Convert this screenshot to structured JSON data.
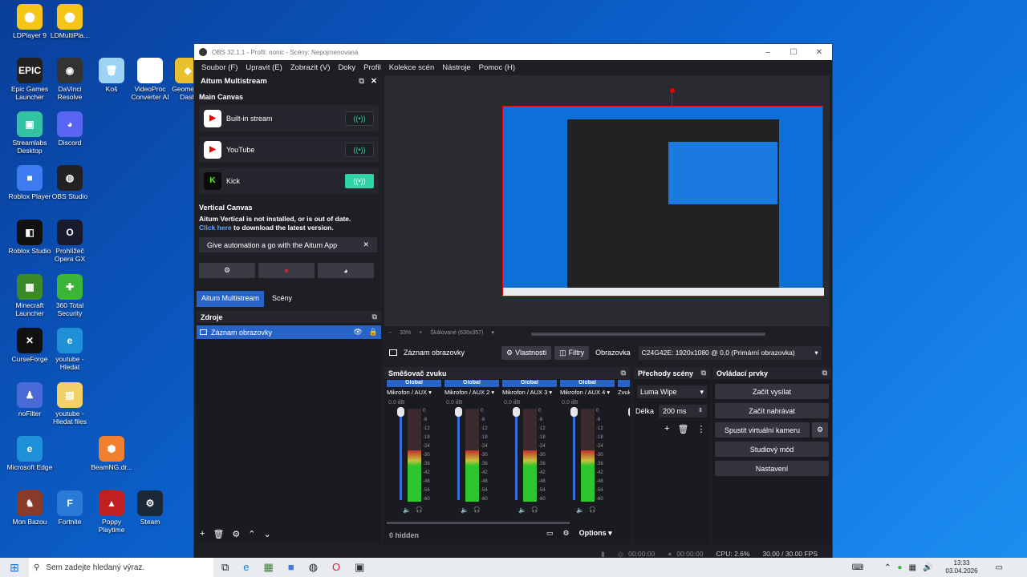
{
  "desktop_icons": [
    {
      "label": "LDPlayer 9",
      "color": "#f5c518",
      "glyph": "⬤"
    },
    {
      "label": "LDMultiPla...",
      "color": "#f5c518",
      "glyph": "⬤"
    },
    {
      "label": "Epic Games Launcher",
      "color": "#222",
      "glyph": "EPIC"
    },
    {
      "label": "DaVinci Resolve",
      "color": "#333",
      "glyph": "◉"
    },
    {
      "label": "Koš",
      "color": "#9fd3f5",
      "glyph": "🗑"
    },
    {
      "label": "VideoProc Converter AI",
      "color": "#fff",
      "glyph": "◎"
    },
    {
      "label": "Geometr... Dash",
      "color": "#e8c030",
      "glyph": "◆"
    },
    {
      "label": "Streamlabs Desktop",
      "color": "#31c3a2",
      "glyph": "▣"
    },
    {
      "label": "Discord",
      "color": "#5865f2",
      "glyph": "◕"
    },
    {
      "label": "Roblox Player",
      "color": "#3c7cf0",
      "glyph": "■"
    },
    {
      "label": "OBS Studio",
      "color": "#222",
      "glyph": "◍"
    },
    {
      "label": "Roblox Studio",
      "color": "#111",
      "glyph": "◧"
    },
    {
      "label": "Prohlížeč Opera GX",
      "color": "#1a1a2e",
      "glyph": "O"
    },
    {
      "label": "Minecraft Launcher",
      "color": "#3a8a2a",
      "glyph": "▦"
    },
    {
      "label": "360 Total Security",
      "color": "#3ab53a",
      "glyph": "✚"
    },
    {
      "label": "CurseForge",
      "color": "#111",
      "glyph": "✕"
    },
    {
      "label": "youtube - Hledat",
      "color": "#1e90d8",
      "glyph": "e"
    },
    {
      "label": "noFilter",
      "color": "#4a6ad8",
      "glyph": "♟"
    },
    {
      "label": "youtube - Hledat files",
      "color": "#f3d06a",
      "glyph": "▤"
    },
    {
      "label": "Microsoft Edge",
      "color": "#1e90d8",
      "glyph": "e"
    },
    {
      "label": "BeamNG.dr...",
      "color": "#f08030",
      "glyph": "⬢"
    },
    {
      "label": "Mon Bazou",
      "color": "#8a3a2a",
      "glyph": "♞"
    },
    {
      "label": "Fortnite",
      "color": "#2a7ad8",
      "glyph": "F"
    },
    {
      "label": "Poppy Playtime",
      "color": "#c02020",
      "glyph": "▲"
    },
    {
      "label": "Steam",
      "color": "#1b2838",
      "glyph": "⚙"
    }
  ],
  "obs": {
    "title": "OBS 32.1.1 - Profil: nonic - Scény: Nepojmenovaná",
    "menu": [
      "Soubor (F)",
      "Upravit (E)",
      "Zobrazit (V)",
      "Doky",
      "Profil",
      "Kolekce scén",
      "Nástroje",
      "Pomoc (H)"
    ],
    "aitum": {
      "header": "Aitum Multistream",
      "main_canvas": "Main Canvas",
      "streams": [
        {
          "name": "Built-in stream",
          "active": false,
          "icon": "youtube-icon"
        },
        {
          "name": "YouTube",
          "active": false,
          "icon": "youtube-icon"
        },
        {
          "name": "Kick",
          "active": true,
          "icon": "kick-icon"
        }
      ],
      "vertical_canvas": "Vertical Canvas",
      "vertical_warning": "Aitum Vertical is not installed, or is out of date.",
      "click_here": "Click here",
      "download_text": " to download the latest version.",
      "promo": "Give automation a go with the Aitum App",
      "tab_multistream": "Aitum Multistream",
      "tab_scenes": "Scény"
    },
    "sources": {
      "header": "Zdroje",
      "items": [
        "Záznam obrazovky"
      ]
    },
    "preview": {
      "zoom": "33%",
      "scaled": "Škálované (636x357)"
    },
    "source_toolbar": {
      "source_name": "Záznam obrazovky",
      "properties": "Vlastnosti",
      "filters": "Filtry",
      "screen_label": "Obrazovka",
      "screen_value": "C24G42E: 1920x1080 @ 0,0 (Primární obrazovka)"
    },
    "mixer": {
      "header": "Směšovač zvuku",
      "channels": [
        {
          "tag": "Global",
          "name": "Mikrofon / AUX",
          "db": "0.0 dB",
          "level": 0.55
        },
        {
          "tag": "Global",
          "name": "Mikrofon / AUX 2",
          "db": "0.0 dB",
          "level": 0.55
        },
        {
          "tag": "Global",
          "name": "Mikrofon / AUX 3",
          "db": "0.0 dB",
          "level": 0.55
        },
        {
          "tag": "Global",
          "name": "Mikrofon / AUX 4",
          "db": "0.0 dB",
          "level": 0.55
        },
        {
          "tag": "G",
          "name": "Zvuk",
          "db": "",
          "level": 0.2
        }
      ],
      "scale": [
        "0",
        "-6",
        "-12",
        "-18",
        "-24",
        "-30",
        "-36",
        "-42",
        "-48",
        "-54",
        "-60"
      ],
      "hidden": "0 hidden",
      "options": "Options"
    },
    "transitions": {
      "header": "Přechody scény",
      "type": "Luma Wipe",
      "duration_label": "Délka",
      "duration": "200 ms"
    },
    "controls": {
      "header": "Ovládací prvky",
      "start_stream": "Začít vysílat",
      "start_record": "Začít nahrávat",
      "virtual_cam": "Spustit virtuální kameru",
      "studio_mode": "Studiový mód",
      "settings": "Nastavení"
    },
    "status": {
      "stream_time": "00:00:00",
      "rec_time": "00:00:00",
      "cpu": "CPU: 2.6%",
      "fps": "30.00 / 30.00 FPS"
    }
  },
  "taskbar": {
    "search_placeholder": "Sem zadejte hledaný výraz.",
    "time": "13:33",
    "date": "03.04.2026"
  }
}
